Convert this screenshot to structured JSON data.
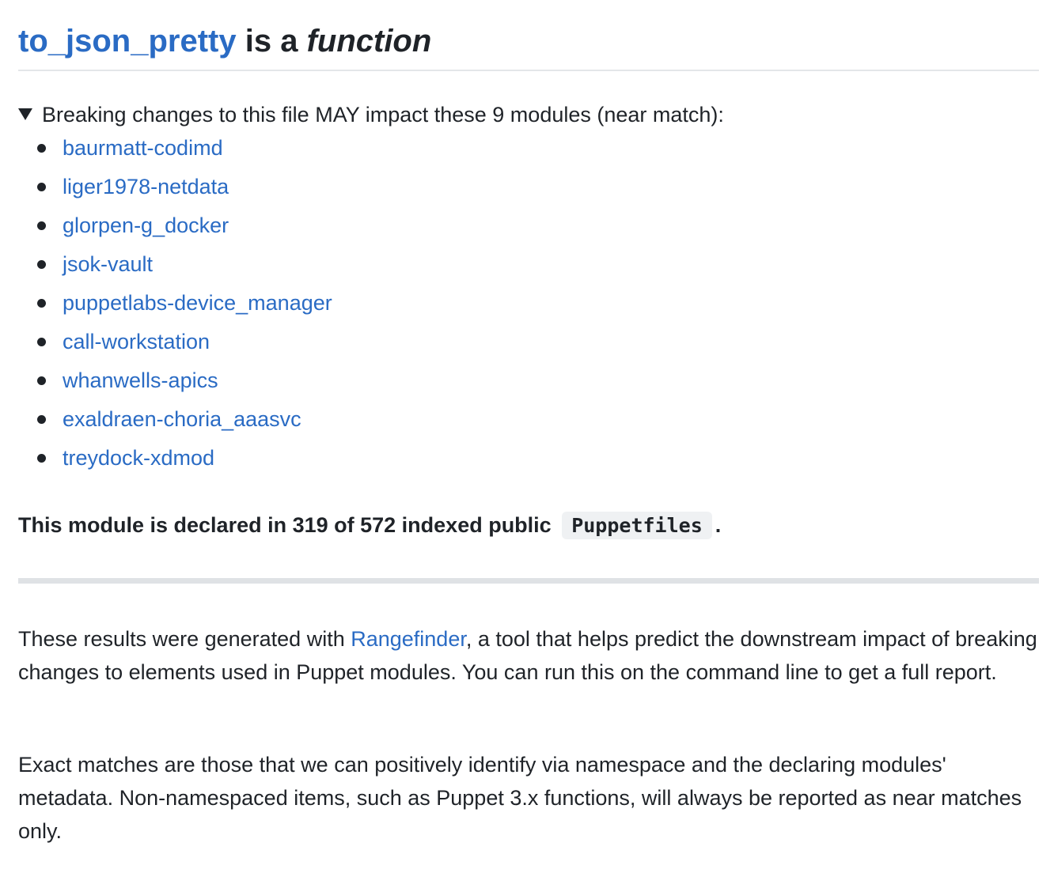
{
  "header": {
    "function_name": "to_json_pretty",
    "is_a_text": " is a ",
    "kind": "function"
  },
  "impact": {
    "summary": "Breaking changes to this file MAY impact these 9 modules (near match):",
    "modules": [
      "baurmatt-codimd",
      "liger1978-netdata",
      "glorpen-g_docker",
      "jsok-vault",
      "puppetlabs-device_manager",
      "call-workstation",
      "whanwells-apics",
      "exaldraen-choria_aaasvc",
      "treydock-xdmod"
    ]
  },
  "declared": {
    "prefix": "This module is declared in 319 of 572 indexed public ",
    "code": "Puppetfiles",
    "suffix": "."
  },
  "footer": {
    "para1_before": "These results were generated with ",
    "para1_link": "Rangefinder",
    "para1_after": ", a tool that helps predict the downstream impact of breaking changes to elements used in Puppet modules. You can run this on the command line to get a full report.",
    "para2": "Exact matches are those that we can positively identify via namespace and the declaring modules' metadata. Non-namespaced items, such as Puppet 3.x functions, will always be reported as near matches only."
  },
  "colors": {
    "link": "#2a6bc4",
    "text": "#1f2328",
    "rule": "#dfe2e5"
  }
}
